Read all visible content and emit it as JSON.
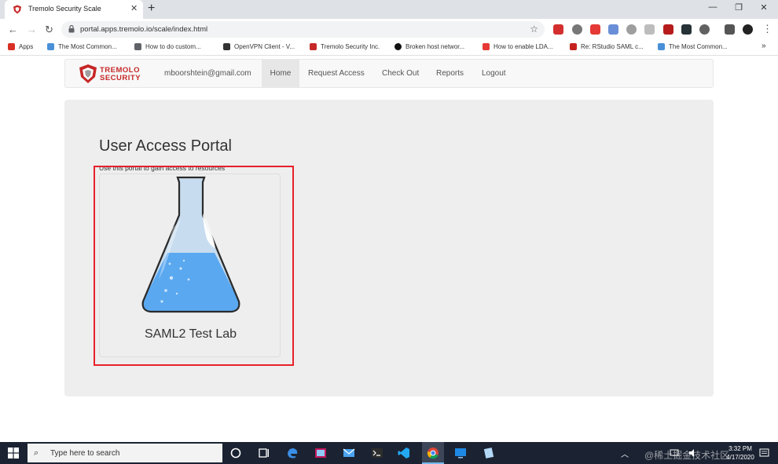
{
  "browser": {
    "tab_title": "Tremolo Security Scale",
    "new_tab": "+",
    "tab_close": "✕",
    "url": "portal.apps.tremolo.io/scale/index.html",
    "window_controls": {
      "minimize": "—",
      "restore": "❐",
      "close": "✕"
    }
  },
  "bookmarks": [
    {
      "label": "Apps",
      "color": "#d93025"
    },
    {
      "label": "The Most Common...",
      "color": "#4a90d9"
    },
    {
      "label": "How to do custom...",
      "color": "#5f6368"
    },
    {
      "label": "OpenVPN Client - V...",
      "color": "#333333"
    },
    {
      "label": "Tremolo Security Inc.",
      "color": "#c62828"
    },
    {
      "label": "Broken host networ...",
      "color": "#111111"
    },
    {
      "label": "How to enable LDA...",
      "color": "#e53935"
    },
    {
      "label": "Re: RStudio SAML c...",
      "color": "#c5221f"
    },
    {
      "label": "The Most Common...",
      "color": "#4a90d9"
    }
  ],
  "bookmarks_more": "»",
  "navbar": {
    "brand_line1": "TREMOLO",
    "brand_line2": "SECURITY",
    "user_email": "mboorshtein@gmail.com",
    "items": [
      "Home",
      "Request Access",
      "Check Out",
      "Reports",
      "Logout"
    ],
    "active": "Home"
  },
  "portal": {
    "title": "User Access Portal",
    "subtitle": "Use this portal to gain access to resources",
    "cards": [
      {
        "label": "SAML2 Test Lab",
        "icon": "flask-icon"
      }
    ]
  },
  "taskbar": {
    "search_placeholder": "Type here to search",
    "time": "3:32 PM",
    "date": "4/17/2020",
    "watermark": "@稀土掘金技术社区"
  },
  "colors": {
    "highlight": "#e8202a",
    "jumbotron": "#eeeeee",
    "taskbar": "#1b2332",
    "flask_liquid": "#5aa8f0"
  }
}
